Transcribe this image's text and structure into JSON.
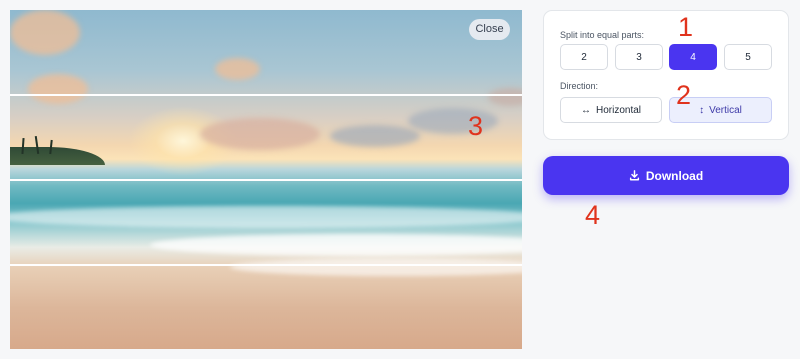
{
  "preview": {
    "close_label": "Close",
    "split_count": 4,
    "split_direction": "horizontal-lines"
  },
  "panel": {
    "parts_label": "Split into equal parts:",
    "parts_options": [
      "2",
      "3",
      "4",
      "5"
    ],
    "parts_selected": "4",
    "direction_label": "Direction:",
    "direction_options": [
      {
        "label": "Horizontal",
        "icon": "horizontal-arrows-icon",
        "glyph": "↔"
      },
      {
        "label": "Vertical",
        "icon": "vertical-arrows-icon",
        "glyph": "↕"
      }
    ],
    "direction_selected": "Vertical"
  },
  "download": {
    "label": "Download",
    "icon": "download-icon"
  },
  "markers": [
    "1",
    "2",
    "3",
    "4"
  ],
  "colors": {
    "accent": "#4a35f0",
    "marker": "#e0331d"
  }
}
